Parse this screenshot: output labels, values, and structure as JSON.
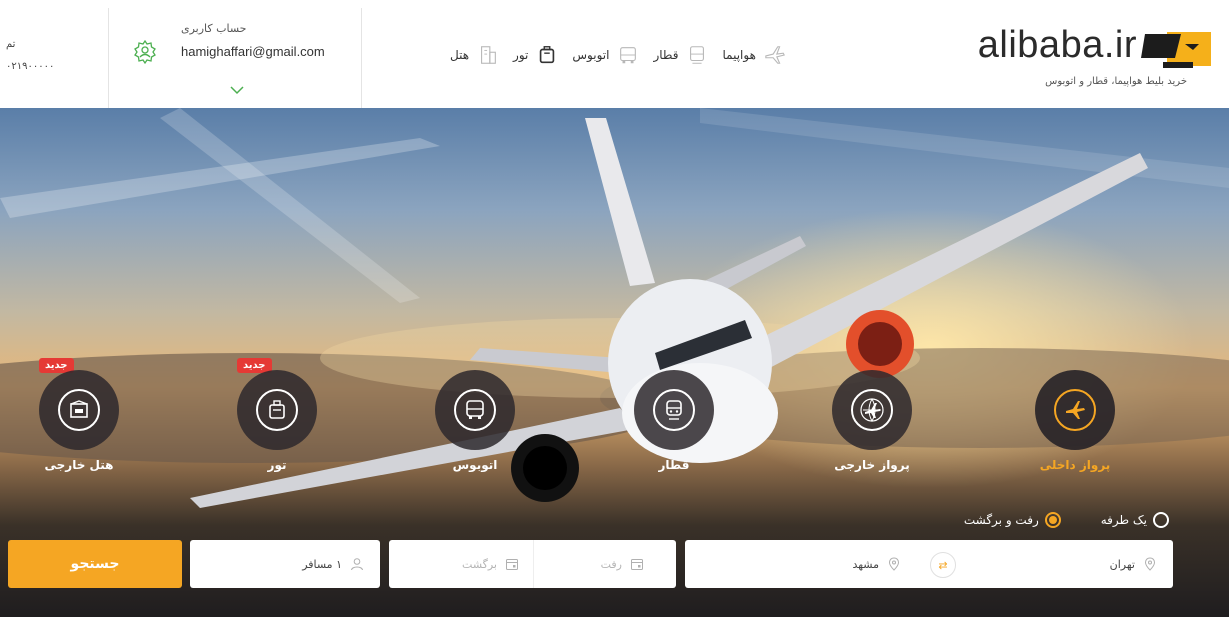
{
  "brand": {
    "name": "alibaba.ir",
    "tagline": "خرید بلیط هواپیما، قطار و اتوبوس",
    "accent": "#f5a623"
  },
  "nav": [
    {
      "label": "هواپیما",
      "icon": "airplane-icon"
    },
    {
      "label": "قطار",
      "icon": "train-icon"
    },
    {
      "label": "اتوبوس",
      "icon": "bus-icon"
    },
    {
      "label": "تور",
      "icon": "tour-icon"
    },
    {
      "label": "هتل",
      "icon": "hotel-icon"
    }
  ],
  "account": {
    "title": "حساب کاربری",
    "email": "hamighaffari@gmail.com"
  },
  "phone": {
    "line1": "تم",
    "line2": "۰۲۱۹۰۰۰۰۰"
  },
  "categories": [
    {
      "label": "پرواز داخلی",
      "icon": "domestic-flight-icon",
      "active": true,
      "badge": ""
    },
    {
      "label": "پرواز خارجی",
      "icon": "international-flight-icon",
      "active": false,
      "badge": ""
    },
    {
      "label": "قطار",
      "icon": "train-icon",
      "active": false,
      "badge": ""
    },
    {
      "label": "اتوبوس",
      "icon": "bus-icon",
      "active": false,
      "badge": ""
    },
    {
      "label": "تور",
      "icon": "tour-icon",
      "active": false,
      "badge": "جدید"
    },
    {
      "label": "هتل خارجی",
      "icon": "hotel-icon",
      "active": false,
      "badge": "جدید"
    }
  ],
  "trip_type": {
    "one_way": "یک طرفه",
    "round_trip": "رفت و برگشت",
    "selected": "round_trip"
  },
  "search": {
    "origin": "تهران",
    "destination": "مشهد",
    "depart_placeholder": "رفت",
    "return_placeholder": "برگشت",
    "passengers": "۱ مسافر",
    "button": "جستجو"
  }
}
